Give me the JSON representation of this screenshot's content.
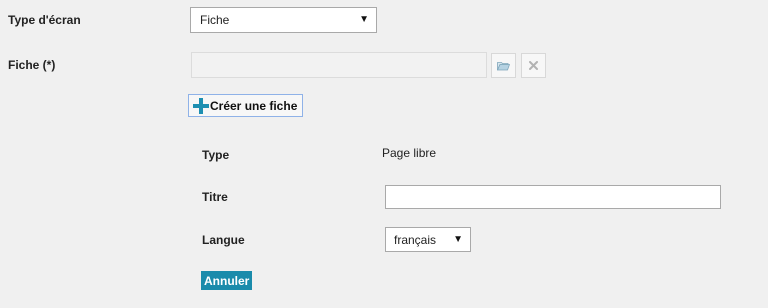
{
  "screen_type": {
    "label": "Type d'écran",
    "selected": "Fiche"
  },
  "fiche": {
    "label": "Fiche (*)",
    "value": ""
  },
  "create_fiche": {
    "label": "Créer une fiche"
  },
  "sub_form": {
    "type_label": "Type",
    "type_value": "Page libre",
    "titre_label": "Titre",
    "titre_value": "",
    "langue_label": "Langue",
    "langue_selected": "français",
    "cancel_label": "Annuler"
  },
  "icons": {
    "browse": "folder-open-icon",
    "clear": "close-icon",
    "add": "plus-icon",
    "dropdown": "caret-down-icon"
  },
  "colors": {
    "accent": "#1a8bab",
    "plus_icon": "#1d8fb1",
    "focus_border": "#8fb2e8",
    "background": "#f0f0f0"
  }
}
